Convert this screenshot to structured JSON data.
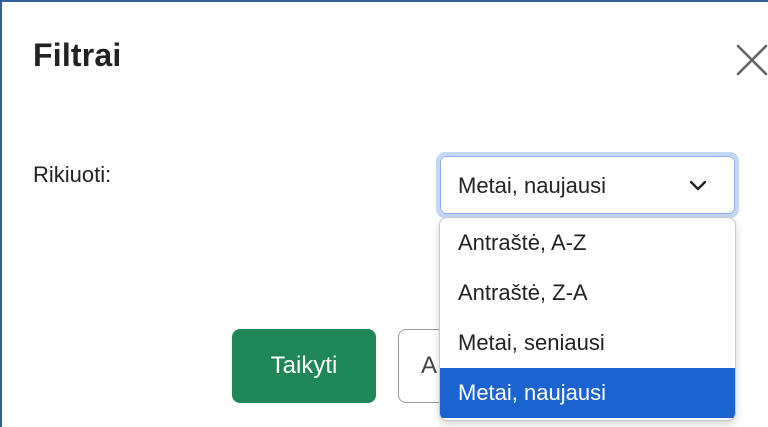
{
  "dialog": {
    "title": "Filtrai",
    "close_icon": "close-icon"
  },
  "sort": {
    "label": "Rikiuoti:",
    "selected_value": "Metai, naujausi",
    "options": [
      {
        "label": "Antraštė, A-Z",
        "selected": false
      },
      {
        "label": "Antraštė, Z-A",
        "selected": false
      },
      {
        "label": "Metai, seniausi",
        "selected": false
      },
      {
        "label": "Metai, naujausi",
        "selected": true
      }
    ]
  },
  "actions": {
    "apply_label": "Taikyti",
    "cancel_label": "A"
  },
  "colors": {
    "apply_button": "#1f8757",
    "selected_option": "#1a63d1",
    "focus_ring": "#c3d8f6",
    "dialog_border": "#2f5f96"
  }
}
